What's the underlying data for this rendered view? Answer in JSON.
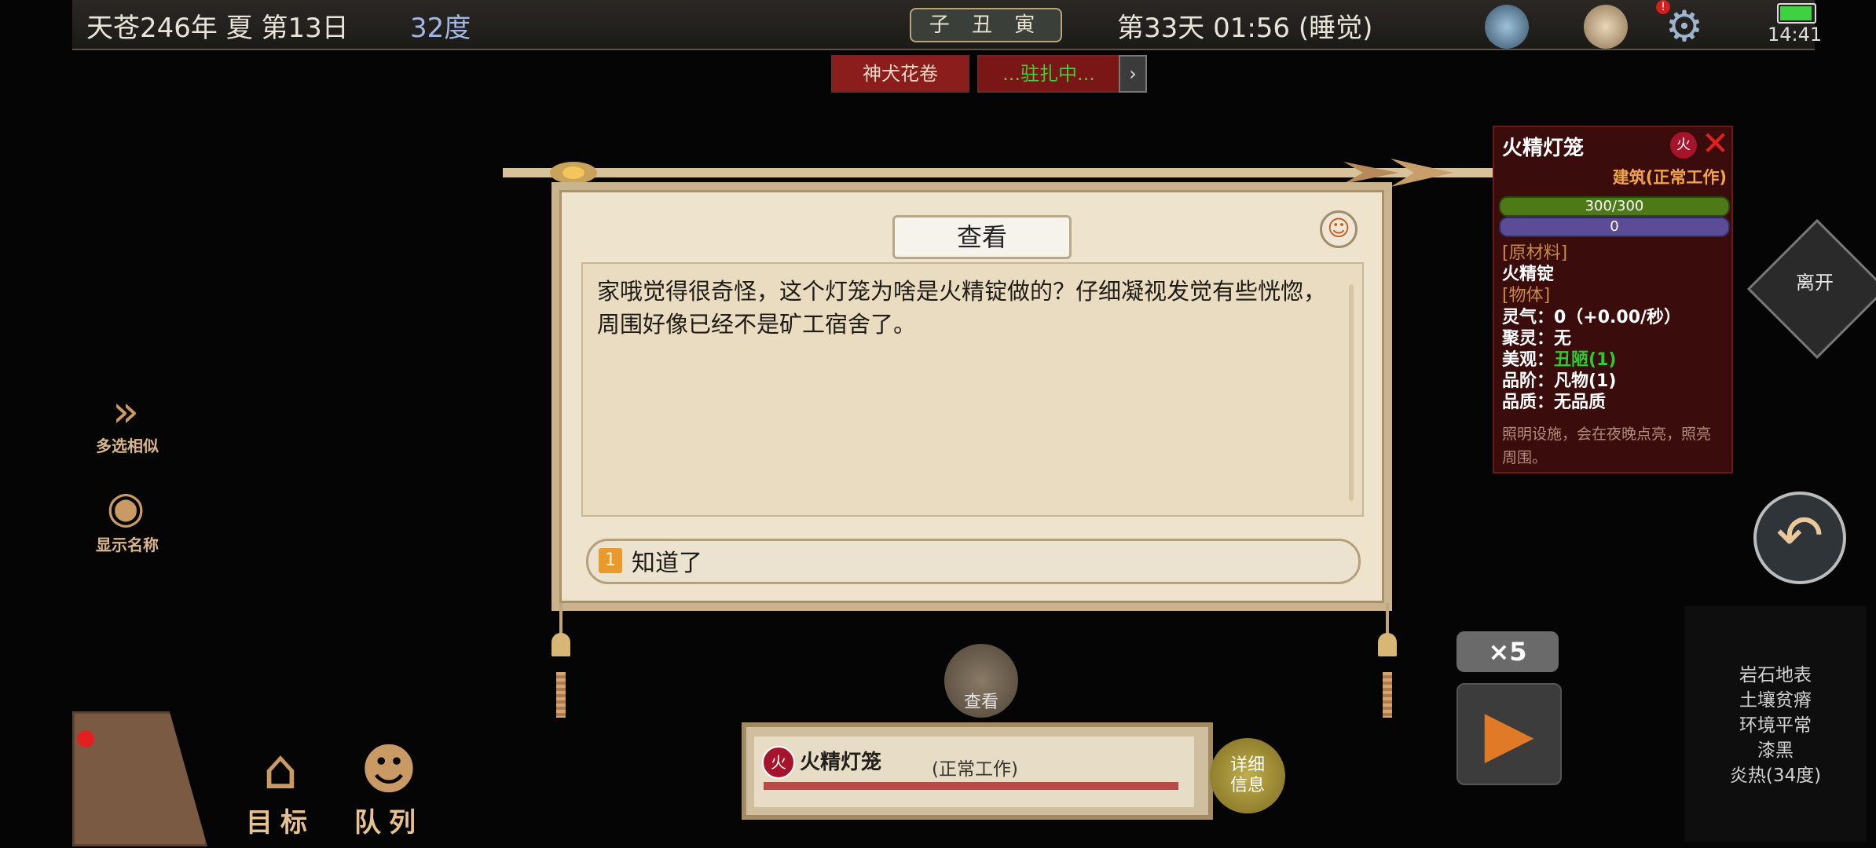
{
  "topbar": {
    "date": "天苍246年 夏 第13日",
    "temperature": "32度",
    "shichen": "子 丑 寅",
    "clock": "第33天 01:56 (睡觉)",
    "system_time": "14:41",
    "battery_level": 0.95
  },
  "tabs": {
    "scroll": "神犬花卷",
    "station": "...驻扎中...",
    "next_icon": "chevron-right-icon"
  },
  "dialog": {
    "title": "查看",
    "message": "家哦觉得很奇怪，这个灯笼为啥是火精锭做的？仔细凝视发觉有些恍惚，周围好像已经不是矿工宿舍了。",
    "reply_number": "1",
    "reply_text": "知道了"
  },
  "left_tools": {
    "multi_select": "多选相似",
    "show_names": "显示名称"
  },
  "info": {
    "title": "火精灯笼",
    "element_badge": "火",
    "status": "建筑(正常工作)",
    "hp": "300/300",
    "second_bar": "0",
    "raw_material_head": "[原材料]",
    "raw_material": "火精锭",
    "object_head": "[物体]",
    "lingqi": "灵气：0（+0.00/秒）",
    "juling": "聚灵：无",
    "meiguan_label": "美观：",
    "meiguan_value": "丑陋(1)",
    "pinjie": "品阶：凡物(1)",
    "pinzhi": "品质：无品质",
    "description": "照明设施，会在夜晚点亮，照亮周围。",
    "accent_color": "#f0a646"
  },
  "side": {
    "leave": "离开"
  },
  "speed": {
    "multiplier": "×5"
  },
  "terrain": [
    "岩石地表",
    "土壤贫瘠",
    "环境平常",
    "漆黑",
    "炎热(34度)"
  ],
  "building_bar": {
    "badge": "火",
    "name": "火精灯笼",
    "status": "(正常工作)",
    "look_label": "查看",
    "detail_label_1": "详细",
    "detail_label_2": "信息"
  },
  "bottom_tools": {
    "target": "目标",
    "queue": "队列"
  }
}
